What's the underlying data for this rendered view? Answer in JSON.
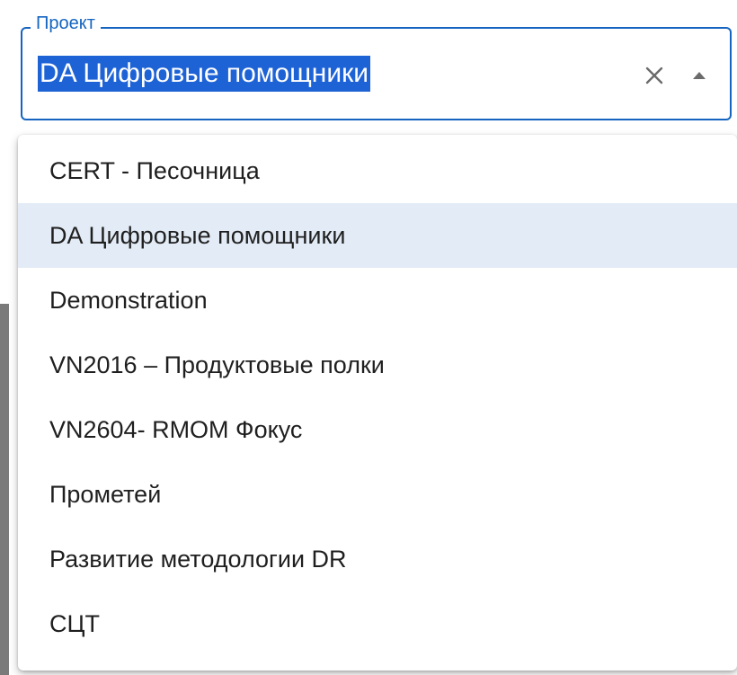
{
  "field": {
    "label": "Проект",
    "value": "DA Цифровые помощники",
    "accent_color": "#1565c0",
    "selection_color": "#1e63d6"
  },
  "icons": {
    "clear": "close-icon",
    "toggle": "arrow-up-icon"
  },
  "options": [
    {
      "label": "CERT - Песочница",
      "selected": false
    },
    {
      "label": "DA Цифровые помощники",
      "selected": true
    },
    {
      "label": "Demonstration",
      "selected": false
    },
    {
      "label": "VN2016 – Продуктовые полки",
      "selected": false
    },
    {
      "label": "VN2604- RMOM Фокус",
      "selected": false
    },
    {
      "label": "Прометей",
      "selected": false
    },
    {
      "label": "Развитие методологии DR",
      "selected": false
    },
    {
      "label": "СЦТ",
      "selected": false
    }
  ]
}
